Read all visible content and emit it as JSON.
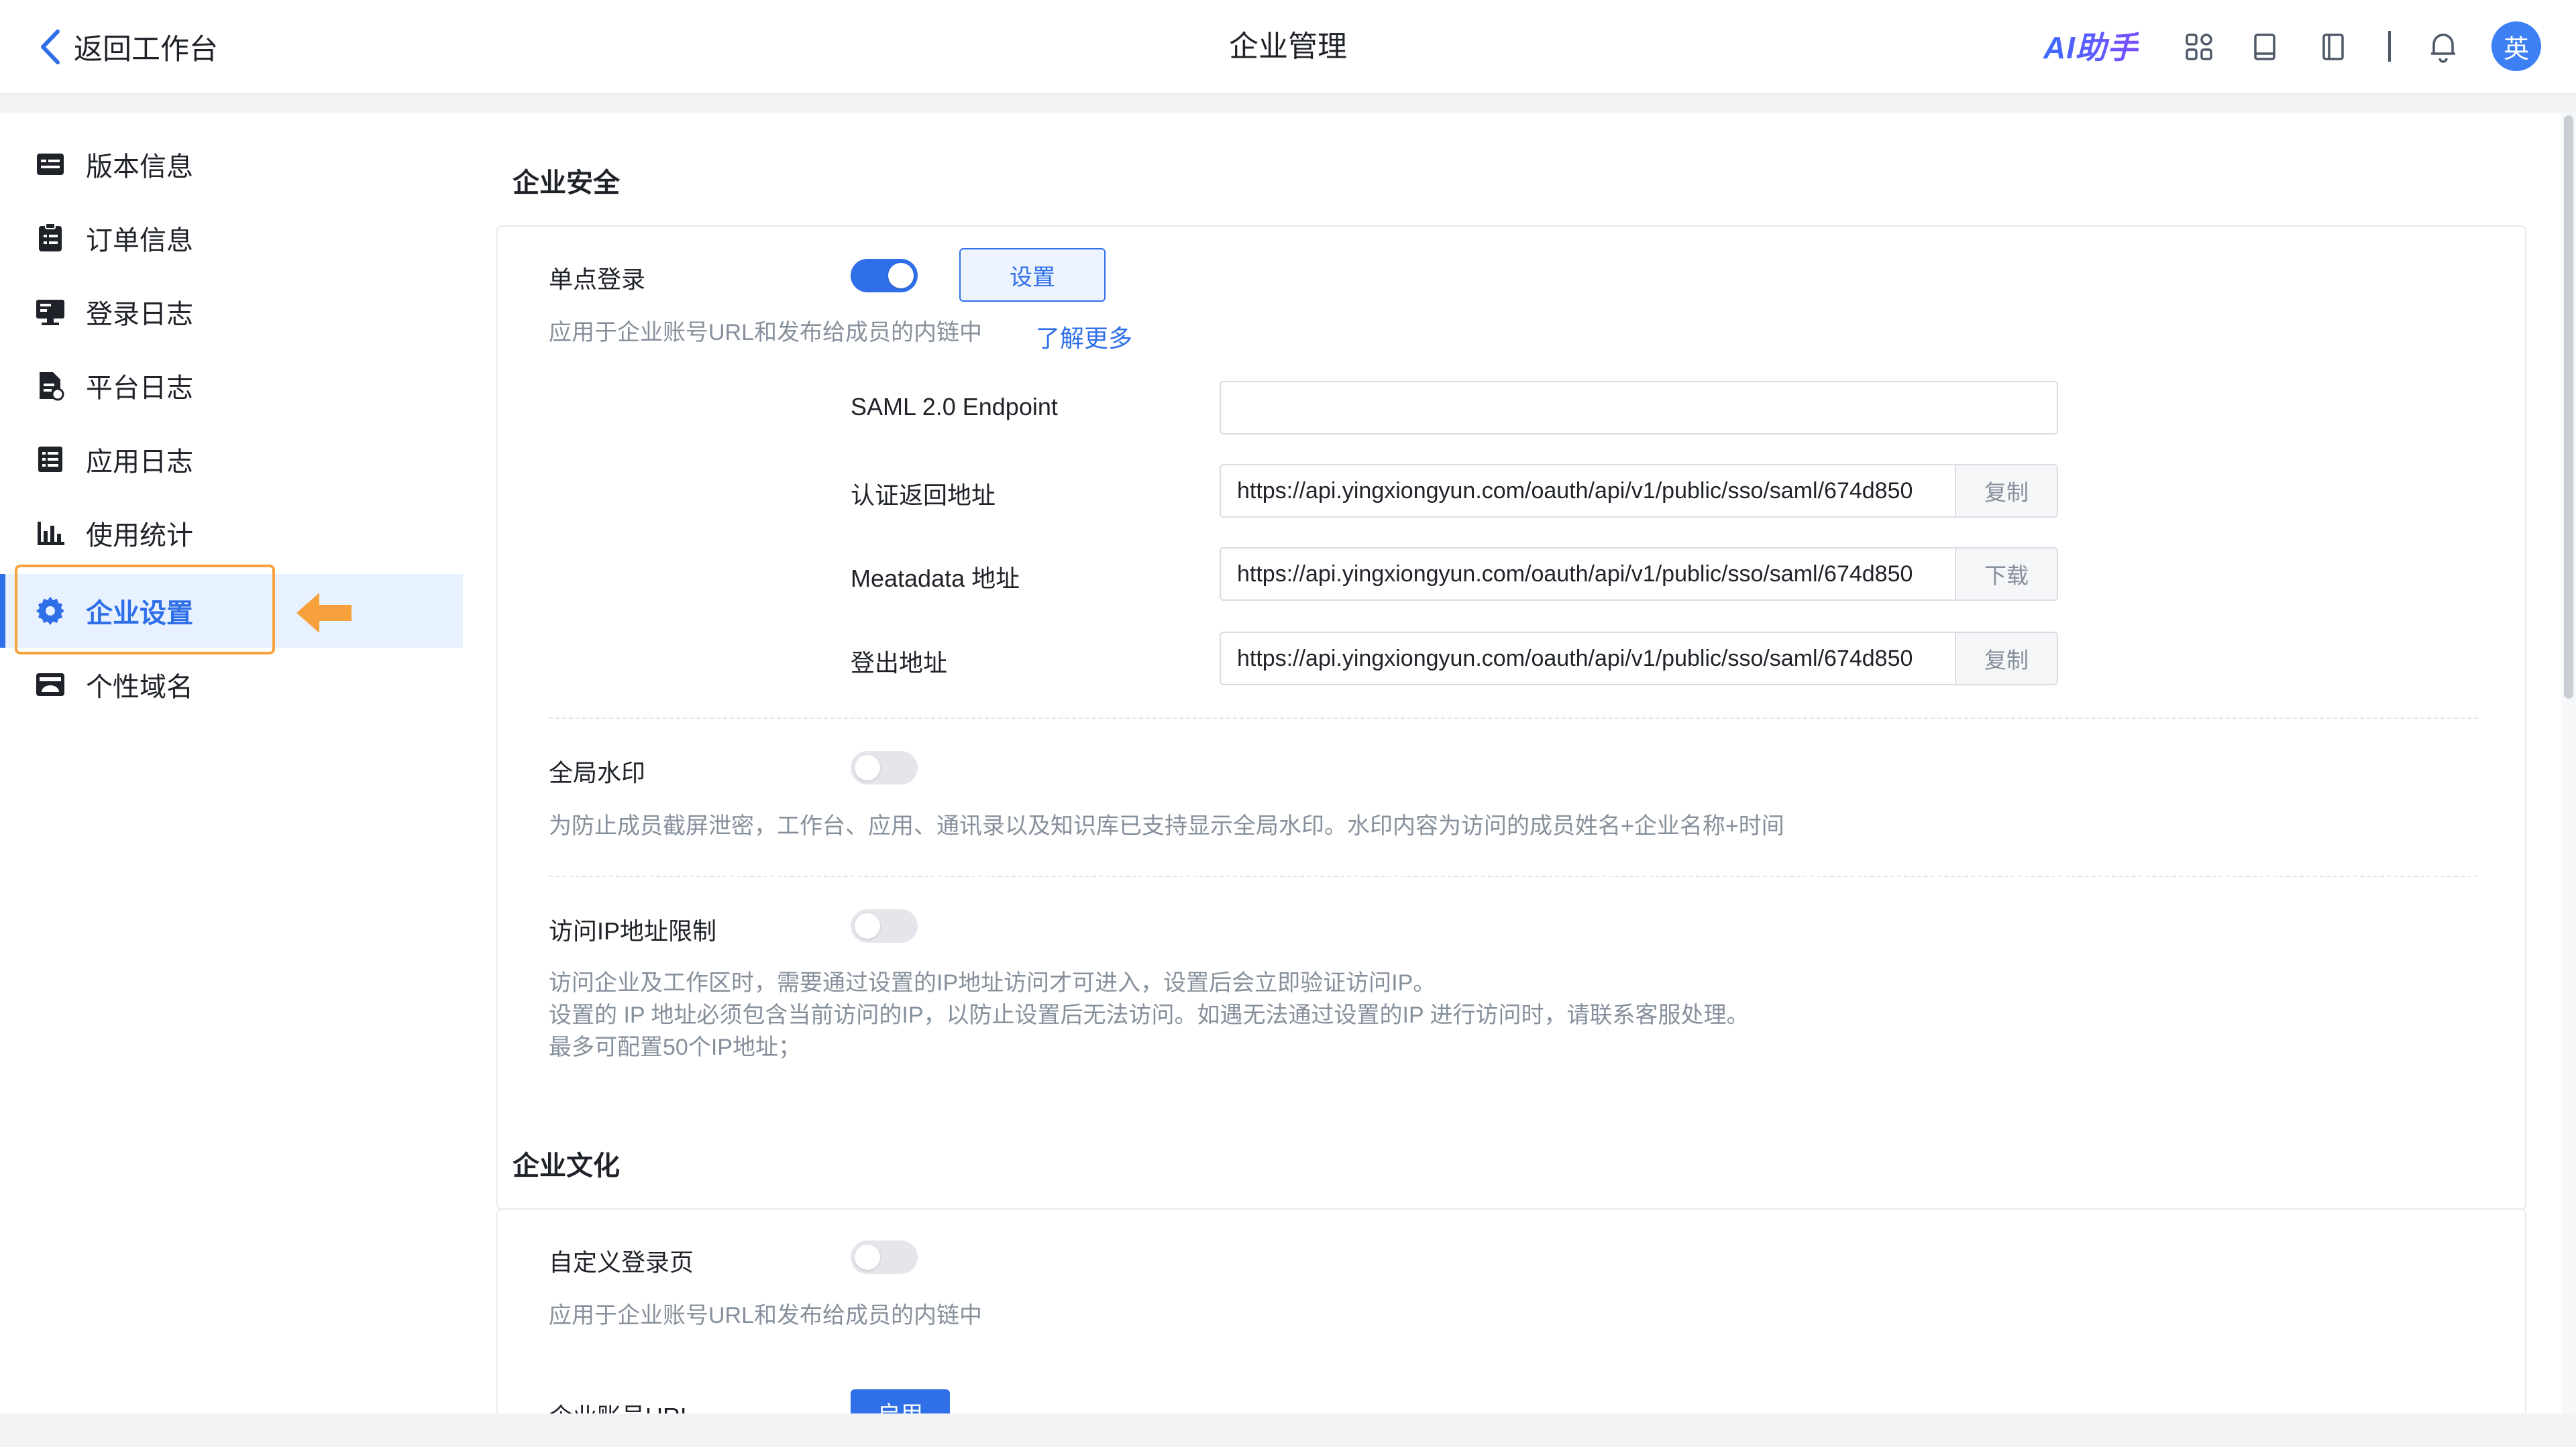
{
  "header": {
    "back_label": "返回工作台",
    "title": "企业管理",
    "ai_label": "AI助手",
    "avatar_text": "英",
    "icons": [
      "apps-icon",
      "book-icon",
      "notebook-icon",
      "divider",
      "bell-icon"
    ]
  },
  "sidebar": {
    "items": [
      {
        "label": "版本信息",
        "icon": "version-icon"
      },
      {
        "label": "订单信息",
        "icon": "order-icon"
      },
      {
        "label": "登录日志",
        "icon": "login-log-icon"
      },
      {
        "label": "平台日志",
        "icon": "platform-log-icon"
      },
      {
        "label": "应用日志",
        "icon": "app-log-icon"
      },
      {
        "label": "使用统计",
        "icon": "chart-icon"
      },
      {
        "label": "企业设置",
        "icon": "gear-icon",
        "active": true
      },
      {
        "label": "个性域名",
        "icon": "domain-icon"
      }
    ]
  },
  "security": {
    "title": "企业安全",
    "sso": {
      "label": "单点登录",
      "enabled": true,
      "settings_button": "设置",
      "desc": "应用于企业账号URL和发布给成员的内链中",
      "learn_more": "了解更多",
      "fields": [
        {
          "label": "SAML 2.0 Endpoint",
          "value": "",
          "action": ""
        },
        {
          "label": "认证返回地址",
          "value": "https://api.yingxiongyun.com/oauth/api/v1/public/sso/saml/674d850",
          "action": "复制"
        },
        {
          "label": "Meatadata 地址",
          "value": "https://api.yingxiongyun.com/oauth/api/v1/public/sso/saml/674d850",
          "action": "下载"
        },
        {
          "label": "登出地址",
          "value": "https://api.yingxiongyun.com/oauth/api/v1/public/sso/saml/674d850",
          "action": "复制"
        }
      ]
    },
    "watermark": {
      "label": "全局水印",
      "enabled": false,
      "desc": "为防止成员截屏泄密，工作台、应用、通讯录以及知识库已支持显示全局水印。水印内容为访问的成员姓名+企业名称+时间"
    },
    "ip_limit": {
      "label": "访问IP地址限制",
      "enabled": false,
      "desc_lines": [
        "访问企业及工作区时，需要通过设置的IP地址访问才可进入，设置后会立即验证访问IP。",
        "设置的 IP 地址必须包含当前访问的IP，以防止设置后无法访问。如遇无法通过设置的IP 进行访问时，请联系客服处理。",
        "最多可配置50个IP地址；"
      ]
    }
  },
  "culture": {
    "title": "企业文化",
    "custom_login": {
      "label": "自定义登录页",
      "enabled": false,
      "desc": "应用于企业账号URL和发布给成员的内链中"
    },
    "account_url": {
      "label": "企业账号URL",
      "button": "启用"
    }
  },
  "colors": {
    "accent": "#2f6fe8",
    "highlight": "#f7a13d"
  }
}
